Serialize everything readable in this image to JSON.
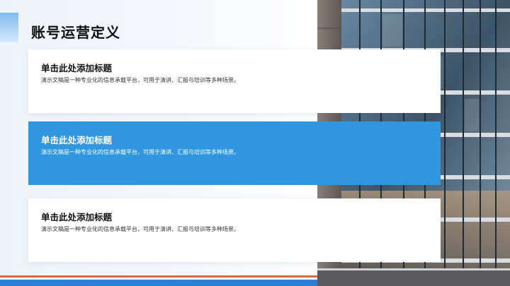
{
  "slide": {
    "title": "账号运营定义"
  },
  "cards": [
    {
      "title": "单击此处添加标题",
      "description": "演示文稿是一种专业化的信息承载平台，可用于演讲、汇报与培训等多种场景。"
    },
    {
      "title": "单击此处添加标题",
      "description": "演示文稿是一种专业化的信息承载平台，可用于演讲、汇报与培训等多种场景。"
    },
    {
      "title": "单击此处添加标题",
      "description": "演示文稿是一种专业化的信息承载平台，可用于演讲、汇报与培训等多种场景。"
    }
  ],
  "colors": {
    "accent_blue": "#2f96df",
    "stripe_blue": "#2d7fd6",
    "stripe_red": "#d66a48"
  }
}
